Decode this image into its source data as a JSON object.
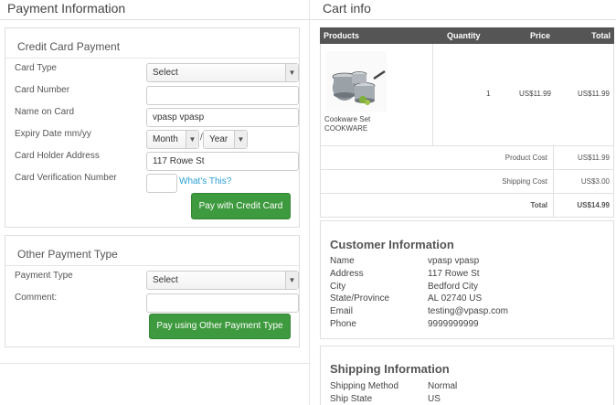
{
  "payment": {
    "title": "Payment Information",
    "credit_card": {
      "heading": "Credit Card Payment",
      "card_type_label": "Card Type",
      "card_type_value": "Select",
      "card_number_label": "Card Number",
      "card_number_value": "",
      "name_on_card_label": "Name on Card",
      "name_on_card_value": "vpasp vpasp",
      "expiry_label": "Expiry Date mm/yy",
      "expiry_month": "Month",
      "expiry_sep": "/",
      "expiry_year": "Year",
      "holder_address_label": "Card Holder Address",
      "holder_address_value": "117 Rowe St",
      "cvn_label": "Card Verification Number",
      "cvn_value": "",
      "whats_this": "What's This?",
      "pay_button": "Pay with Credit Card"
    },
    "other": {
      "heading": "Other Payment Type",
      "payment_type_label": "Payment Type",
      "payment_type_value": "Select",
      "comment_label": "Comment:",
      "comment_value": "",
      "pay_button": "Pay using Other Payment Type"
    }
  },
  "cart": {
    "title": "Cart info",
    "headers": {
      "products": "Products",
      "quantity": "Quantity",
      "price": "Price",
      "total": "Total"
    },
    "item": {
      "name": "Cookware Set",
      "code": "COOKWARE",
      "quantity": "1",
      "price": "US$11.99",
      "total": "US$11.99",
      "image_icon": "cookware-image"
    },
    "product_cost_label": "Product Cost",
    "product_cost_value": "US$11.99",
    "shipping_cost_label": "Shipping Cost",
    "shipping_cost_value": "US$3.00",
    "total_label": "Total",
    "total_value": "US$14.99"
  },
  "customer": {
    "title": "Customer Information",
    "fields": [
      {
        "label": "Name",
        "value": "vpasp vpasp"
      },
      {
        "label": "Address",
        "value": "117 Rowe St"
      },
      {
        "label": "City",
        "value": "Bedford City"
      },
      {
        "label": "State/Province",
        "value": "AL 02740 US"
      },
      {
        "label": "Email",
        "value": "testing@vpasp.com"
      },
      {
        "label": "Phone",
        "value": "9999999999"
      }
    ]
  },
  "shipping": {
    "title": "Shipping Information",
    "fields": [
      {
        "label": "Shipping Method",
        "value": "Normal"
      },
      {
        "label": "Ship State",
        "value": "US"
      }
    ]
  },
  "colors": {
    "button_green": "#3e9a3e",
    "link_blue": "#2a9fd6",
    "table_header": "#555555"
  }
}
